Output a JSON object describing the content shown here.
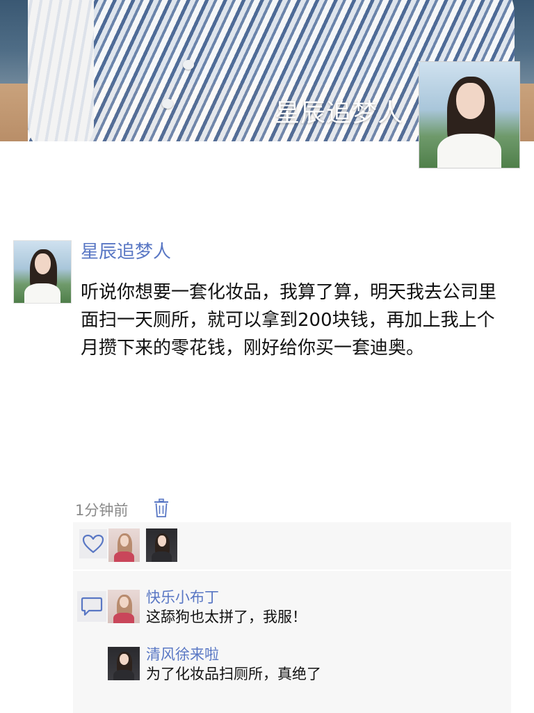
{
  "profile": {
    "display_name": "星辰追梦人",
    "avatar_icon": "woman-portrait-avatar"
  },
  "post": {
    "author": "星辰追梦人",
    "text": "听说你想要一套化妆品，我算了算，明天我去公司里面扫一天厕所，就可以拿到200块钱，再加上我上个月攒下来的零花钱，刚好给你买一套迪奥。",
    "time": "1分钟前",
    "delete_icon": "trash-icon"
  },
  "likes": {
    "icon": "heart-icon",
    "count": 2
  },
  "comments": [
    {
      "author": "快乐小布丁",
      "text": "这舔狗也太拼了，我服！"
    },
    {
      "author": "清风徐来啦",
      "text": "为了化妆品扫厕所，真绝了"
    }
  ],
  "colors": {
    "link_blue": "#5977c4",
    "panel_bg": "#f7f7f7",
    "meta_gray": "#8a8a8a"
  }
}
